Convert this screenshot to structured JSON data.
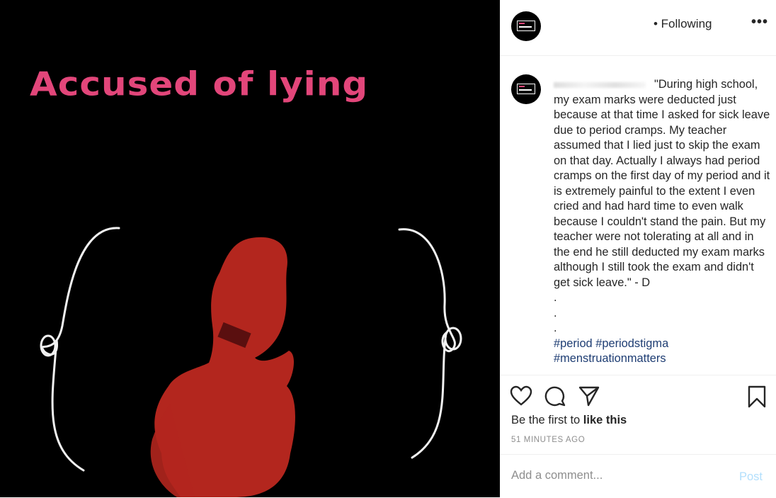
{
  "media": {
    "headline": "Accused of lying",
    "colors": {
      "background": "#000000",
      "headline": "#e2467a",
      "statue": "#b3261e",
      "tape": "#5a0f0f"
    }
  },
  "header": {
    "follow_status": "• Following",
    "more_icon": "more-horizontal-icon"
  },
  "caption": {
    "text": "\"During high school, my exam marks were deducted just because at that time I asked for sick leave due to period cramps. My teacher assumed that I lied just to skip the exam on that day. Actually I always had period cramps on the first day of my period and it is extremely painful to the extent I even cried and had hard time to even walk because I couldn't stand the pain. But my teacher were not tolerating at all and in the end he still deducted my exam marks although I still took the exam and didn't get sick leave.\" - D\n.\n.\n.",
    "hashtags": "#period #periodstigma\n#menstruationmatters"
  },
  "actions": {
    "icons": [
      "heart-icon",
      "comment-icon",
      "share-icon",
      "bookmark-icon"
    ],
    "likes_prefix": "Be the first to ",
    "likes_link": "like this",
    "timestamp": "51 MINUTES AGO"
  },
  "comment": {
    "placeholder": "Add a comment...",
    "post_label": "Post"
  }
}
